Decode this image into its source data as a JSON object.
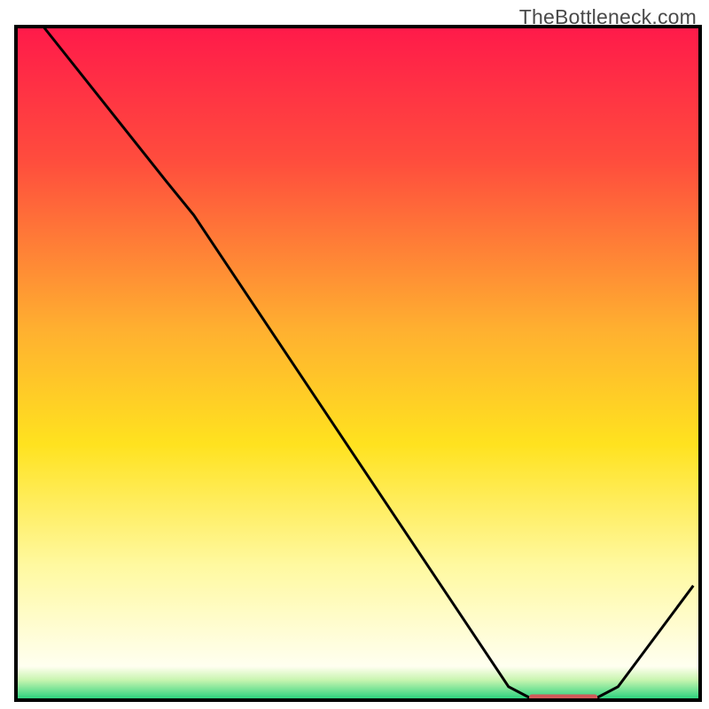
{
  "watermark": "TheBottleneck.com",
  "chart_data": {
    "type": "line",
    "title": "",
    "xlabel": "",
    "ylabel": "",
    "xlim": [
      0,
      100
    ],
    "ylim": [
      0,
      100
    ],
    "gradient_stops": [
      {
        "offset": 0,
        "color": "#ff1a4a"
      },
      {
        "offset": 20,
        "color": "#ff4d3d"
      },
      {
        "offset": 45,
        "color": "#ffb030"
      },
      {
        "offset": 62,
        "color": "#ffe21f"
      },
      {
        "offset": 80,
        "color": "#fff9a0"
      },
      {
        "offset": 95,
        "color": "#fffff0"
      },
      {
        "offset": 97,
        "color": "#c8f5b0"
      },
      {
        "offset": 100,
        "color": "#1fcf7a"
      }
    ],
    "curve": [
      {
        "x": 4.0,
        "y": 100.0
      },
      {
        "x": 22.0,
        "y": 77.0
      },
      {
        "x": 26.0,
        "y": 72.0
      },
      {
        "x": 72.0,
        "y": 2.0
      },
      {
        "x": 75.0,
        "y": 0.4
      },
      {
        "x": 85.0,
        "y": 0.4
      },
      {
        "x": 88.0,
        "y": 2.0
      },
      {
        "x": 99.0,
        "y": 17.0
      }
    ],
    "marker_segment": {
      "x_start": 75.0,
      "x_end": 85.0,
      "y": 0.4,
      "color": "#d15a5a"
    },
    "frame_color": "#000000",
    "curve_color": "#000000"
  }
}
